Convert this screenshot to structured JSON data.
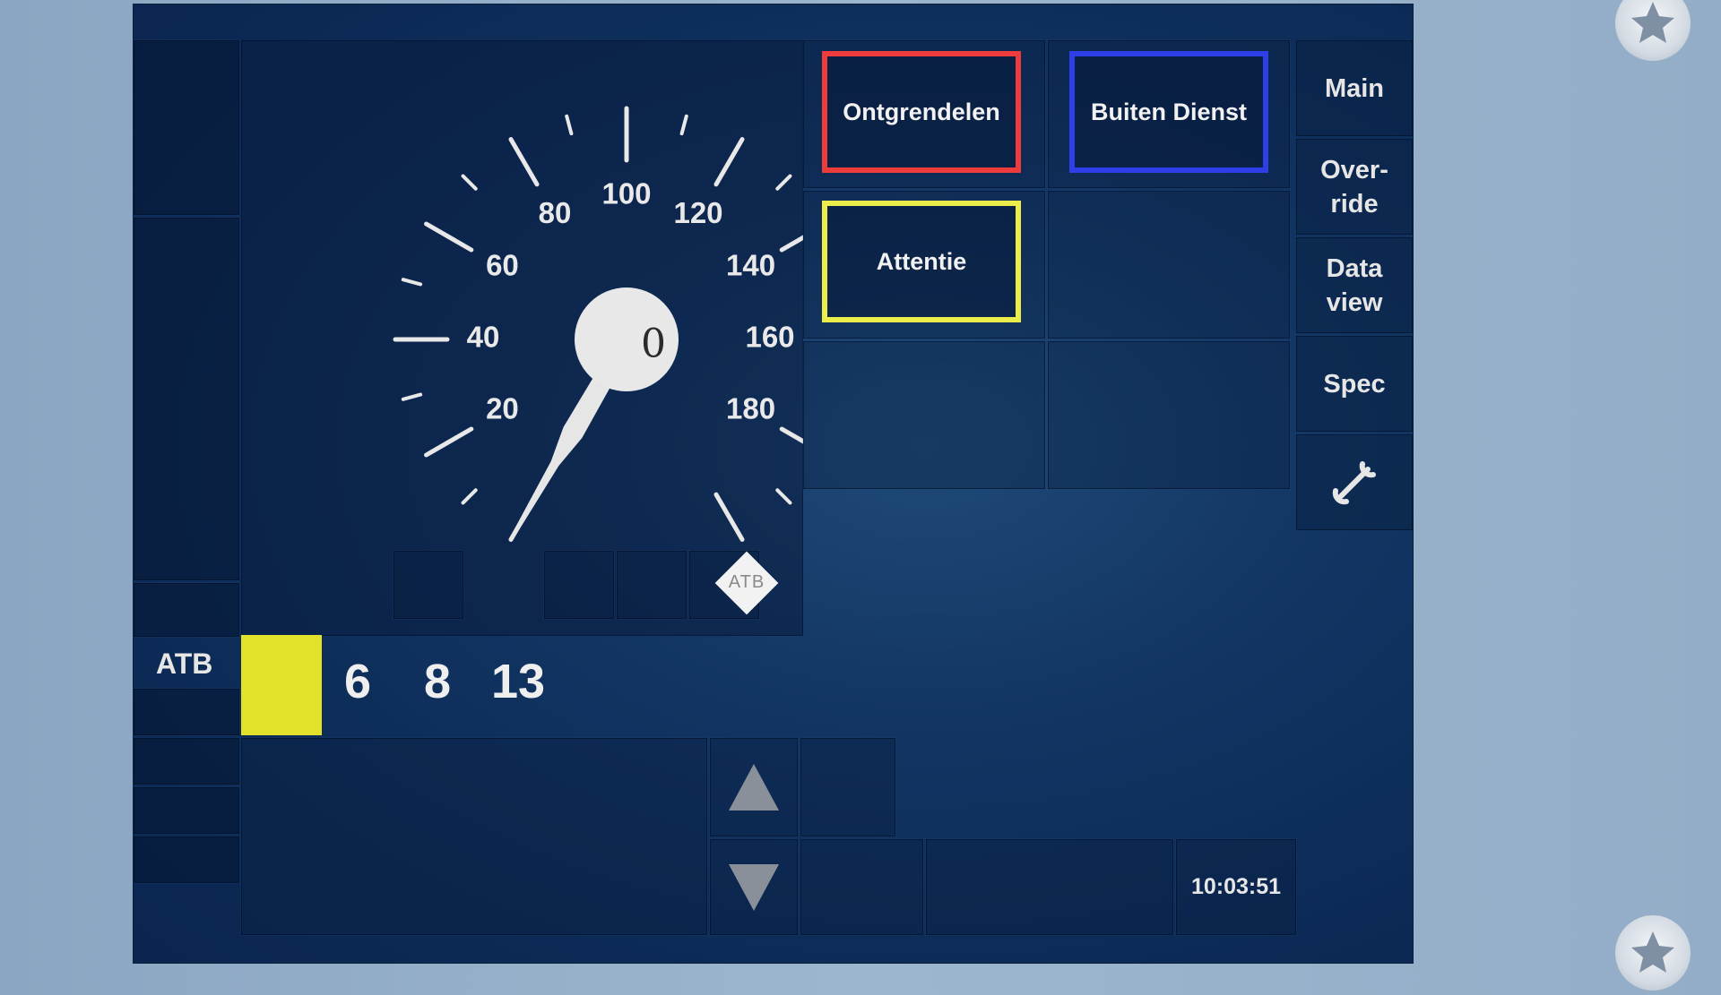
{
  "dial": {
    "labels": [
      "20",
      "40",
      "60",
      "80",
      "100",
      "120",
      "140",
      "160",
      "180"
    ],
    "speed_value": "0",
    "atb_badge": "ATB"
  },
  "buttons": {
    "ontgrendelen": "Ontgrendelen",
    "buiten_dienst": "Buiten Dienst",
    "attentie": "Attentie"
  },
  "sidebar": {
    "main": "Main",
    "override_line1": "Over-",
    "override_line2": "ride",
    "dataview_line1": "Data",
    "dataview_line2": "view",
    "spec": "Spec",
    "settings_icon": "wrench-icon"
  },
  "atb": {
    "label": "ATB",
    "values": [
      "6",
      "8",
      "13"
    ],
    "indicator_color": "#e2e22a"
  },
  "clock": "10:03:51",
  "colors": {
    "ontgrendelen_border": "#ee3b3b",
    "buiten_dienst_border": "#2f3fe8",
    "attentie_border": "#ecec4a"
  }
}
